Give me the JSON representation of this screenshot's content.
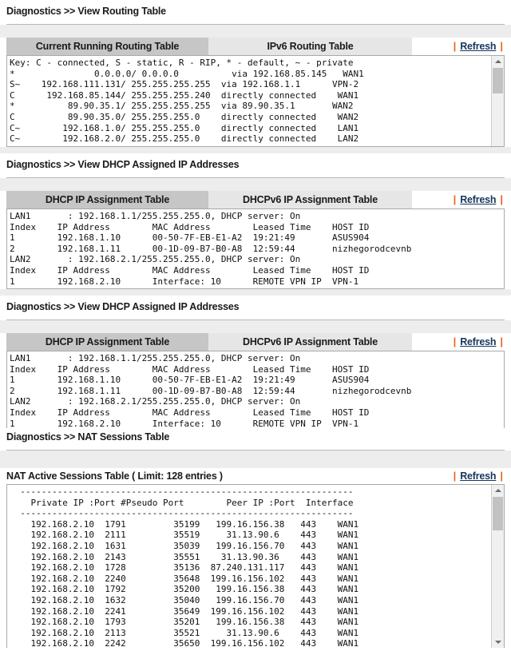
{
  "sections": {
    "routing": {
      "heading": "Diagnostics >> View Routing Table",
      "tabs": [
        {
          "label": "Current Running Routing Table",
          "active": true
        },
        {
          "label": "IPv6 Routing Table",
          "active": false
        }
      ],
      "refresh_label": "Refresh",
      "separator": "|",
      "content": "Key: C - connected, S - static, R - RIP, * - default, ~ - private\n*               0.0.0.0/ 0.0.0.0          via 192.168.85.145   WAN1\nS~    192.168.111.131/ 255.255.255.255  via 192.168.1.1      VPN-2\nC      192.168.85.144/ 255.255.255.240  directly connected    WAN1\n*          89.90.35.1/ 255.255.255.255  via 89.90.35.1       WAN2\nC          89.90.35.0/ 255.255.255.0    directly connected    WAN2\nC~        192.168.1.0/ 255.255.255.0    directly connected    LAN1\nC~        192.168.2.0/ 255.255.255.0    directly connected    LAN2"
    },
    "dhcp_first": {
      "heading": "Diagnostics >> View DHCP Assigned IP Addresses",
      "tabs": [
        {
          "label": "DHCP IP Assignment Table",
          "active": true
        },
        {
          "label": "DHCPv6 IP Assignment Table",
          "active": false
        }
      ],
      "refresh_label": "Refresh",
      "separator": "|",
      "content": "LAN1       : 192.168.1.1/255.255.255.0, DHCP server: On\nIndex    IP Address        MAC Address        Leased Time    HOST ID\n1        192.168.1.10      00-50-7F-EB-E1-A2  19:21:49       ASUS904\n2        192.168.1.11      00-1D-09-B7-B0-A8  12:59:44       nizhegorodcevnb\nLAN2       : 192.168.2.1/255.255.255.0, DHCP server: On\nIndex    IP Address        MAC Address        Leased Time    HOST ID\n1        192.168.2.10      Interface: 10      REMOTE VPN IP  VPN-1"
    },
    "dhcp_second": {
      "heading": "Diagnostics >> View DHCP Assigned IP Addresses",
      "tabs": [
        {
          "label": "DHCP IP Assignment Table",
          "active": true
        },
        {
          "label": "DHCPv6 IP Assignment Table",
          "active": false
        }
      ],
      "refresh_label": "Refresh",
      "separator": "|",
      "content": "LAN1       : 192.168.1.1/255.255.255.0, DHCP server: On\nIndex    IP Address        MAC Address        Leased Time    HOST ID\n1        192.168.1.10      00-50-7F-EB-E1-A2  19:21:49       ASUS904\n2        192.168.1.11      00-1D-09-B7-B0-A8  12:59:44       nizhegorodcevnb\nLAN2       : 192.168.2.1/255.255.255.0, DHCP server: On\nIndex    IP Address        MAC Address        Leased Time    HOST ID\n1        192.168.2.10      Interface: 10      REMOTE VPN IP  VPN-1"
    },
    "nat": {
      "heading": "Diagnostics >> NAT Sessions Table",
      "title": "NAT Active Sessions Table ( Limit: 128 entries )",
      "refresh_label": "Refresh",
      "separator": "|",
      "content": "  ---------------------------------------------------------------\n    Private IP :Port #Pseudo Port        Peer IP :Port  Interface\n  ---------------------------------------------------------------\n    192.168.2.10  1791         35199   199.16.156.38   443    WAN1\n    192.168.2.10  2111         35519     31.13.90.6    443    WAN1\n    192.168.2.10  1631         35039   199.16.156.70   443    WAN1\n    192.168.2.10  2143         35551    31.13.90.36    443    WAN1\n    192.168.2.10  1728         35136  87.240.131.117   443    WAN1\n    192.168.2.10  2240         35648  199.16.156.102   443    WAN1\n    192.168.2.10  1792         35200   199.16.156.38   443    WAN1\n    192.168.2.10  1632         35040   199.16.156.70   443    WAN1\n    192.168.2.10  2241         35649  199.16.156.102   443    WAN1\n    192.168.2.10  1793         35201   199.16.156.38   443    WAN1\n    192.168.2.10  2113         35521     31.13.90.6    443    WAN1\n    192.168.2.10  2242         35650  199.16.156.102   443    WAN1"
    }
  },
  "colors": {
    "tab_active": "#c6c6c6",
    "tab_inactive": "#e6e6e6",
    "separator_orange": "#e8651a",
    "link": "#17365d",
    "gutter": "#ededed"
  }
}
